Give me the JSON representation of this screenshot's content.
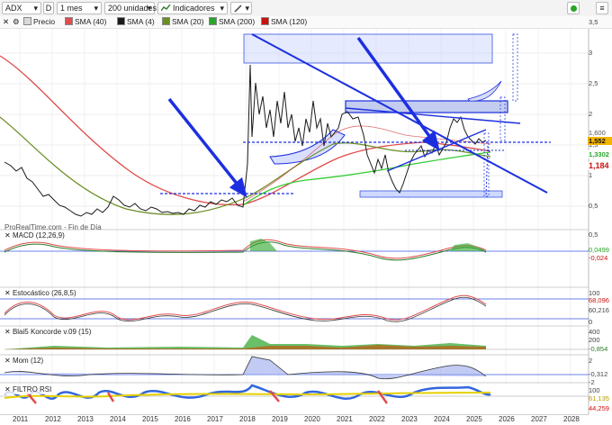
{
  "toolbar": {
    "symbol": "ADX",
    "data_label": "D",
    "period": "1 mes",
    "units": "200 unidades",
    "indicators_label": "Indicadores"
  },
  "legend": {
    "items": [
      {
        "label": "Precio",
        "color": "#d9d9d9"
      },
      {
        "label": "SMA (40)",
        "color": "#e04b4b"
      },
      {
        "label": "SMA (4)",
        "color": "#1a1a1a"
      },
      {
        "label": "SMA (20)",
        "color": "#6b8e23"
      },
      {
        "label": "SMA (200)",
        "color": "#2aa52a"
      },
      {
        "label": "SMA (120)",
        "color": "#cc1111"
      }
    ]
  },
  "watermark": "ProRealTime.com - Fin de Día",
  "price_axis": [
    "3,5",
    "3",
    "2,5",
    "2",
    "1,5",
    "1",
    "0,5"
  ],
  "price_tags": {
    "last": "1,552",
    "sma_green": "1,3302",
    "sma_red": "1,184",
    "sma_top": "1,600"
  },
  "panels": {
    "macd": {
      "title": "MACD (12,26,9)",
      "axis": [
        "0,5",
        "0",
        "-0,5"
      ],
      "tags": [
        "0,0499",
        "-0,024"
      ]
    },
    "stoch": {
      "title": "Estocástico (26,8,5)",
      "axis": [
        "100",
        "50",
        "0"
      ],
      "tags": [
        "68,096",
        "60,216"
      ]
    },
    "blai5": {
      "title": "Blai5 Koncorde v.09 (15)",
      "axis": [
        "400",
        "200",
        "0"
      ],
      "tags": [
        "-0,854"
      ]
    },
    "mom": {
      "title": "Mom (12)",
      "axis": [
        "2",
        "0",
        "-2"
      ],
      "tags": [
        "-0,312"
      ]
    },
    "rsi": {
      "title": "FILTRO RSI",
      "axis": [
        "100",
        "50"
      ],
      "tags": [
        "61,135",
        "44,259"
      ]
    }
  },
  "x_axis": [
    "2011",
    "2012",
    "2013",
    "2014",
    "2015",
    "2016",
    "2017",
    "2018",
    "2019",
    "2020",
    "2021",
    "2022",
    "2023",
    "2024",
    "2025",
    "2026",
    "2027",
    "2028"
  ],
  "colors": {
    "bg": "#ffffff",
    "grid": "#e6e6e6",
    "trend": "#1c2fe0",
    "zone_fill": "#cfd9ff"
  }
}
